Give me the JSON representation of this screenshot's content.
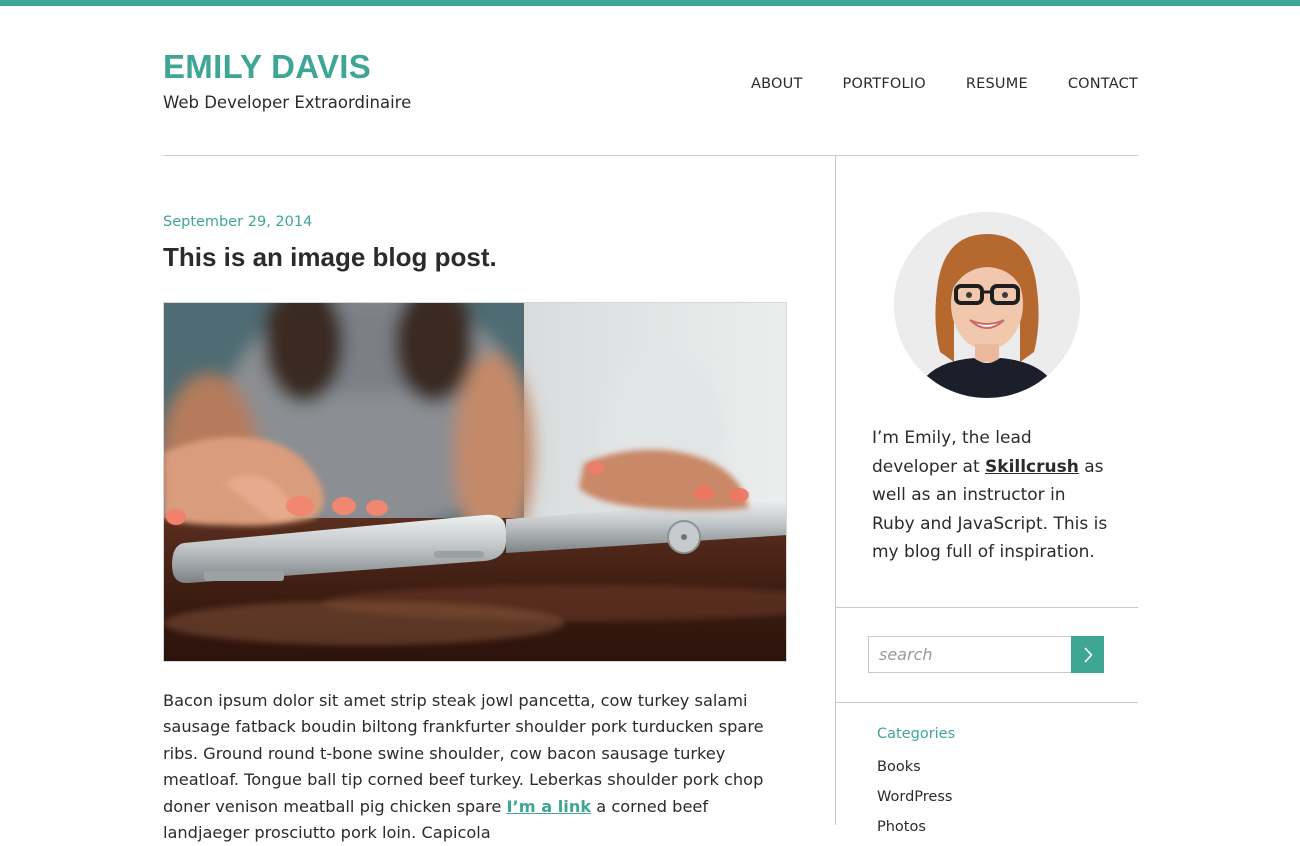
{
  "header": {
    "site_title": "EMILY DAVIS",
    "tagline": "Web Developer Extraordinaire",
    "nav": [
      {
        "label": "ABOUT"
      },
      {
        "label": "PORTFOLIO"
      },
      {
        "label": "RESUME"
      },
      {
        "label": "CONTACT"
      }
    ]
  },
  "post": {
    "date": "September 29, 2014",
    "title": "This is an image blog post.",
    "body_before_link": "Bacon ipsum dolor sit amet strip steak jowl pancetta, cow turkey salami sausage fatback boudin biltong frankfurter shoulder pork turducken spare ribs. Ground round t-bone swine shoulder, cow bacon sausage turkey meatloaf. Tongue ball tip corned beef turkey. Leberkas shoulder pork chop doner venison meatball pig chicken spare ",
    "link_text": "I’m a link",
    "body_after_link": " a corned beef landjaeger prosciutto pork loin. Capicola"
  },
  "sidebar": {
    "bio_before_link": "I’m Emily, the lead developer at ",
    "bio_link": "Skillcrush",
    "bio_after_link": " as well as an instructor in Ruby and JavaScript. This is my blog full of inspiration.",
    "search": {
      "placeholder": "search"
    },
    "categories_heading": "Categories",
    "categories": [
      {
        "label": "Books"
      },
      {
        "label": "WordPress"
      },
      {
        "label": "Photos"
      }
    ]
  },
  "colors": {
    "accent": "#3fa696",
    "text": "#2b2b2b",
    "rule": "#c9c9c9"
  },
  "icons": {
    "search_button": "chevron-right-icon"
  }
}
